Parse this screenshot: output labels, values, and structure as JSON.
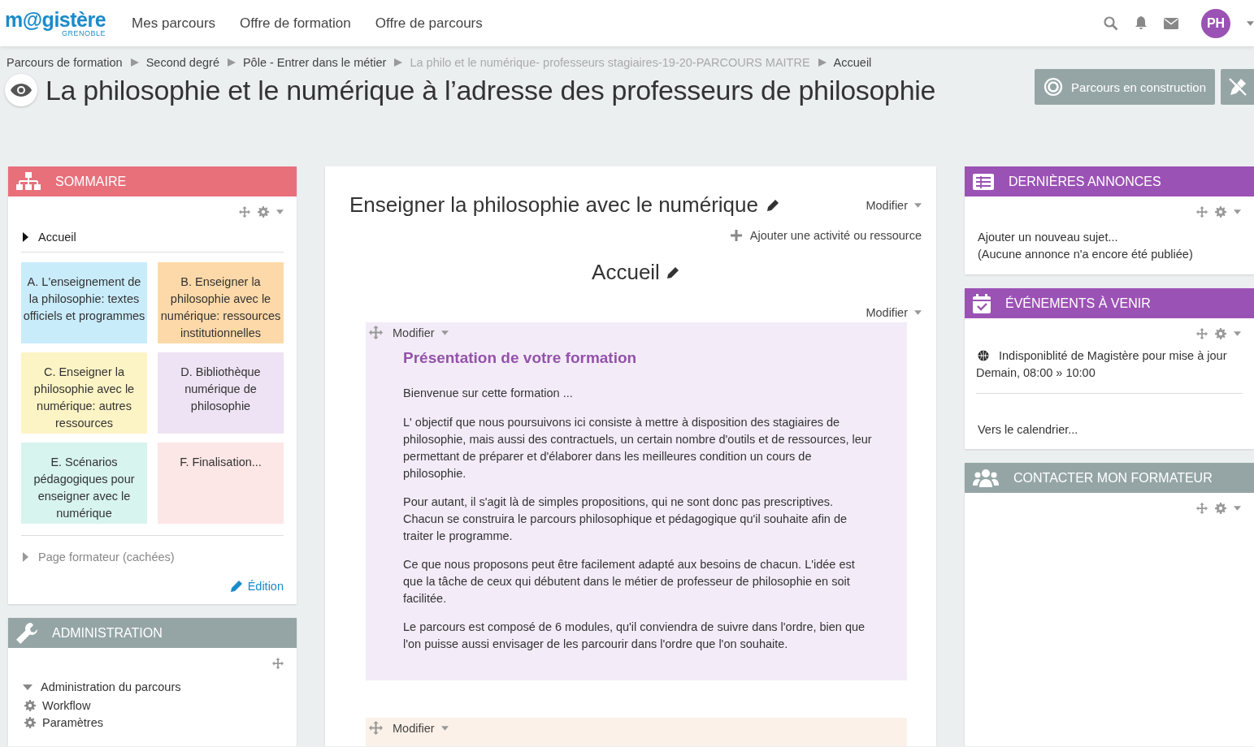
{
  "header": {
    "logo": "m@gistère",
    "logo_subtitle": "GRENOBLE",
    "nav": [
      "Mes parcours",
      "Offre de formation",
      "Offre de parcours"
    ],
    "avatar": "PH"
  },
  "breadcrumb": [
    {
      "label": "Parcours de formation",
      "muted": false
    },
    {
      "label": "Second degré",
      "muted": false
    },
    {
      "label": "Pôle - Entrer dans le métier",
      "muted": false
    },
    {
      "label": "La philo et le numérique- professeurs stagiaires-19-20-PARCOURS MAITRE",
      "muted": true
    },
    {
      "label": "Accueil",
      "muted": false
    }
  ],
  "page_title": "La philosophie et le numérique à l’adresse des professeurs de philosophie",
  "status_button": "Parcours en construction",
  "left_column": [
    {
      "kind": "summary",
      "title": "SOMMAIRE",
      "color": "#e8707b",
      "menu": true,
      "sections": [
        {
          "label": "Accueil",
          "hidden": false,
          "tiles": [
            {
              "label": "A. L'enseignement de la philosophie: textes officiels et programmes",
              "color": "#c9ecfa"
            },
            {
              "label": "B. Enseigner la philosophie avec le numérique: ressources institutionnelles",
              "color": "#fdd9a9"
            },
            {
              "label": "C. Enseigner la philosophie avec le numérique: autres ressources",
              "color": "#fdf4c5"
            },
            {
              "label": "D. Bibliothèque numérique de philosophie",
              "color": "#eee3f4"
            },
            {
              "label": "E. Scénarios pédagogiques pour enseigner avec le numérique",
              "color": "#d7f4ef"
            },
            {
              "label": "F. Finalisation...",
              "color": "#fde6e6"
            }
          ]
        },
        {
          "label": "Page formateur (cachées)",
          "hidden": true
        }
      ],
      "edit_link": "Édition"
    },
    {
      "kind": "administration",
      "title": "ADMINISTRATION",
      "color": "#95a5a6",
      "menu": false,
      "tree": [
        {
          "label": "Administration du parcours",
          "expanded": true,
          "children": [
            {
              "label": "Workflow"
            },
            {
              "label": "Paramètres"
            }
          ]
        }
      ]
    }
  ],
  "main": {
    "title": "Enseigner la philosophie avec le numérique",
    "menu": "Modifier",
    "add_activity": "Ajouter une activité ou ressource",
    "topic": {
      "title": "Accueil",
      "menu": "Modifier",
      "activities": [
        {
          "menu": "Modifier",
          "color": "#f3ecf8",
          "title": "Présentation de votre formation",
          "paragraphs": [
            "Bienvenue sur cette formation ...",
            "L' objectif que nous poursuivons ici consiste à mettre à disposition des stagiaires de philosophie, mais aussi des contractuels, un certain nombre d'outils et de ressources, leur permettant de préparer et d'élaborer dans les meilleures condition un cours de philosophie.",
            "Pour autant, il s'agit là de simples propositions, qui ne sont donc pas prescriptives. Chacun se construira le parcours philosophique et pédagogique qu'il souhaite afin de traiter le programme.",
            "Ce que nous proposons peut être facilement adapté aux besoins de chacun. L'idée est que la tâche de ceux qui débutent dans le métier de professeur de philosophie en soit facilitée.",
            "Le parcours est composé de 6 modules, qu'il conviendra de suivre dans l'ordre, bien que l'on puisse aussi envisager de les parcourir dans l'ordre que l'on souhaite."
          ]
        },
        {
          "menu": "Modifier",
          "color": "#fbf1e8"
        }
      ]
    }
  },
  "right_column": [
    {
      "kind": "announcements",
      "title": "DERNIÈRES ANNONCES",
      "color": "#9b52b5",
      "menu": true,
      "lines": [
        "Ajouter un nouveau sujet...",
        "(Aucune annonce n'a encore été publiée)"
      ]
    },
    {
      "kind": "events",
      "title": "ÉVÉNEMENTS À VENIR",
      "color": "#9b52b5",
      "menu": true,
      "events": [
        {
          "title": "Indisponiblité de Magistère pour mise à jour",
          "time": "Demain, 08:00 » 10:00"
        }
      ],
      "link": "Vers le calendrier..."
    },
    {
      "kind": "contact",
      "title": "CONTACTER MON FORMATEUR",
      "color": "#95a5a6",
      "menu": true
    }
  ]
}
